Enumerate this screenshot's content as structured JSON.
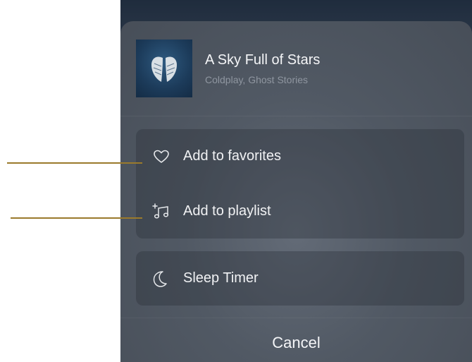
{
  "now_playing": {
    "title": "A Sky Full of Stars",
    "subtitle": "Coldplay, Ghost Stories"
  },
  "actions": [
    {
      "label": "Add to favorites",
      "icon": "heart-icon"
    },
    {
      "label": "Add to playlist",
      "icon": "add-to-playlist-icon"
    }
  ],
  "sleep": {
    "label": "Sleep Timer",
    "icon": "moon-icon"
  },
  "cancel_label": "Cancel",
  "colors": {
    "sheet": "#515964",
    "text": "#f1f2f4",
    "subtext": "#8f96a0",
    "callout": "#9a7a2c"
  }
}
